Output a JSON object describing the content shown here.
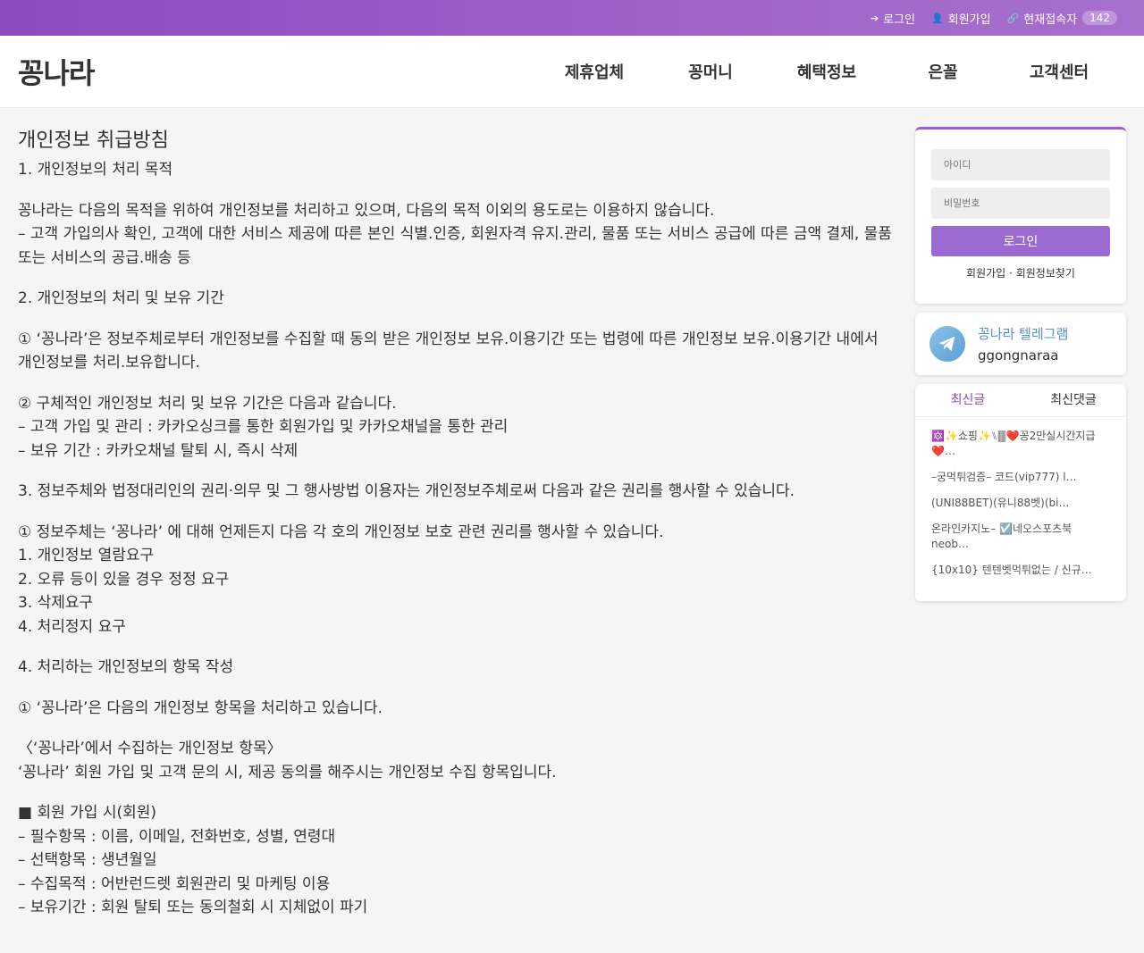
{
  "topbar": {
    "login_label": "로그인",
    "signup_label": "회원가입",
    "visitors_label": "현재접속자",
    "visitors_count": "142"
  },
  "header": {
    "logo": "꽁나라",
    "nav": [
      "제휴업체",
      "꽁머니",
      "혜택정보",
      "은꼴",
      "고객센터"
    ]
  },
  "main": {
    "title": "개인정보 취급방침",
    "paragraphs": [
      [
        "1. 개인정보의 처리 목적"
      ],
      [
        " 꽁나라는 다음의 목적을 위하여 개인정보를 처리하고 있으며, 다음의 목적 이외의 용도로는 이용하지 않습니다.",
        "– 고객 가입의사 확인, 고객에 대한 서비스 제공에 따른 본인 식별.인증, 회원자격 유지.관리, 물품 또는 서비스 공급에 따른 금액 결제, 물품 또는 서비스의 공급.배송 등"
      ],
      [
        "2. 개인정보의 처리 및 보유 기간"
      ],
      [
        "① ‘꽁나라’은 정보주체로부터 개인정보를 수집할 때 동의 받은 개인정보 보유.이용기간 또는 법령에 따른 개인정보 보유.이용기간 내에서 개인정보를 처리.보유합니다."
      ],
      [
        "② 구체적인 개인정보 처리 및 보유 기간은 다음과 같습니다.",
        "– 고객 가입 및 관리 : 카카오싱크를 통한 회원가입 및 카카오채널을 통한 관리",
        "– 보유 기간 : 카카오채널 탈퇴 시, 즉시 삭제"
      ],
      [
        "3. 정보주체와 법정대리인의 권리·의무 및 그 행사방법 이용자는 개인정보주체로써 다음과 같은 권리를 행사할 수 있습니다."
      ],
      [
        "① 정보주체는 ‘꽁나라’ 에 대해 언제든지 다음 각 호의 개인정보 보호 관련 권리를 행사할 수 있습니다.",
        "1. 개인정보 열람요구",
        "2. 오류 등이 있을 경우 정정 요구",
        "3. 삭제요구",
        "4. 처리정지 요구"
      ],
      [
        "4. 처리하는 개인정보의 항목 작성"
      ],
      [
        "① ‘꽁나라’은 다음의 개인정보 항목을 처리하고 있습니다."
      ],
      [
        "〈‘꽁나라’에서 수집하는 개인정보 항목〉",
        "‘꽁나라’ 회원 가입 및 고객 문의 시, 제공 동의를 해주시는 개인정보 수집 항목입니다."
      ],
      [
        "■ 회원 가입 시(회원)",
        "– 필수항목 : 이름, 이메일, 전화번호, 성별, 연령대",
        "– 선택항목 : 생년월일",
        "– 수집목적 : 어반런드렛 회원관리 및 마케팅 이용",
        "– 보유기간 : 회원 탈퇴 또는 동의철회 시 지체없이 파기"
      ]
    ]
  },
  "sidebar": {
    "login": {
      "id_placeholder": "아이디",
      "pw_placeholder": "비밀번호",
      "button": "로그인",
      "signup_link": "회원가입",
      "separator": "·",
      "find_link": "회원정보찾기"
    },
    "telegram": {
      "title": "꽁나라 텔레그램",
      "handle": "ggongnaraa"
    },
    "recent": {
      "tab_posts": "최신글",
      "tab_comments": "최신댓글",
      "posts": [
        "🔯✨쇼핑✨⑊🀫❤️꽁2만실시간지급❤️…",
        "–궁먹튀검증– 코드(vip777) l…",
        "(UNI88BET)(유니88벳)(bi…",
        "온라인카지노– ☑️네오스포츠북 neob…",
        "{10x10} 텐텐벳먹튀없는 / 신규…"
      ]
    }
  },
  "colors": {
    "accent": "#9b5fcf",
    "topbar_start": "#8c4cc0",
    "topbar_end": "#a66fce",
    "telegram_blue": "#5a8ed0"
  }
}
